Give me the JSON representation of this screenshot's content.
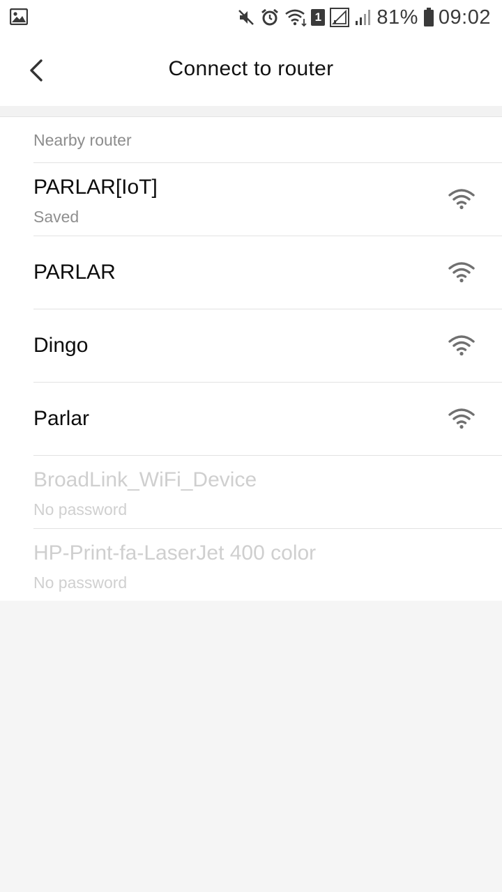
{
  "status_bar": {
    "icons": [
      "gallery-icon",
      "mute-icon",
      "alarm-icon",
      "wifi-data-icon",
      "sim1-icon",
      "signal-1-icon",
      "signal-2-icon",
      "battery-icon"
    ],
    "sim_label": "1",
    "battery_percent": "81%",
    "time": "09:02"
  },
  "header": {
    "back_icon": "chevron-left-icon",
    "title": "Connect to router"
  },
  "list": {
    "section_label": "Nearby router",
    "networks": [
      {
        "name": "PARLAR[IoT]",
        "subtitle": "Saved",
        "icon": "wifi-icon",
        "enabled": true
      },
      {
        "name": "PARLAR",
        "subtitle": "",
        "icon": "wifi-icon",
        "enabled": true
      },
      {
        "name": "Dingo",
        "subtitle": "",
        "icon": "wifi-icon",
        "enabled": true
      },
      {
        "name": "Parlar",
        "subtitle": "",
        "icon": "wifi-icon",
        "enabled": true
      },
      {
        "name": "BroadLink_WiFi_Device",
        "subtitle": "No password",
        "icon": "",
        "enabled": false
      },
      {
        "name": "HP-Print-fa-LaserJet 400 color",
        "subtitle": "No password",
        "icon": "",
        "enabled": false
      }
    ]
  },
  "colors": {
    "background": "#f5f5f5",
    "surface": "#ffffff",
    "text_primary": "#0d0d0d",
    "text_secondary": "#8f8f8f",
    "text_disabled": "#cfcfcf",
    "icon": "#707070"
  }
}
